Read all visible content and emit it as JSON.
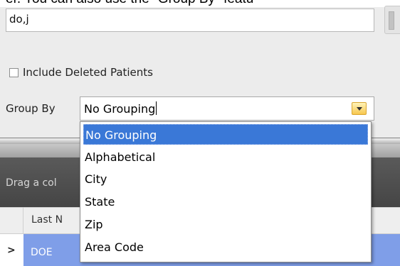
{
  "header_text": "er. You can also use the \"Group By\" featu",
  "search": {
    "value": "do,j"
  },
  "include_deleted": {
    "label": "Include Deleted Patients",
    "checked": false
  },
  "group_by": {
    "label": "Group By",
    "selected": "No Grouping",
    "options": [
      "No Grouping",
      "Alphabetical",
      "City",
      "State",
      "Zip",
      "Area Code"
    ]
  },
  "grid": {
    "drag_hint": "Drag a col",
    "column_header": "Last N",
    "row_indicator": ">",
    "row_value": "DOE"
  },
  "colors": {
    "selection": "#3a78d7",
    "row_highlight": "#7f9ee8",
    "dark_panel": "#4f4f4f"
  }
}
